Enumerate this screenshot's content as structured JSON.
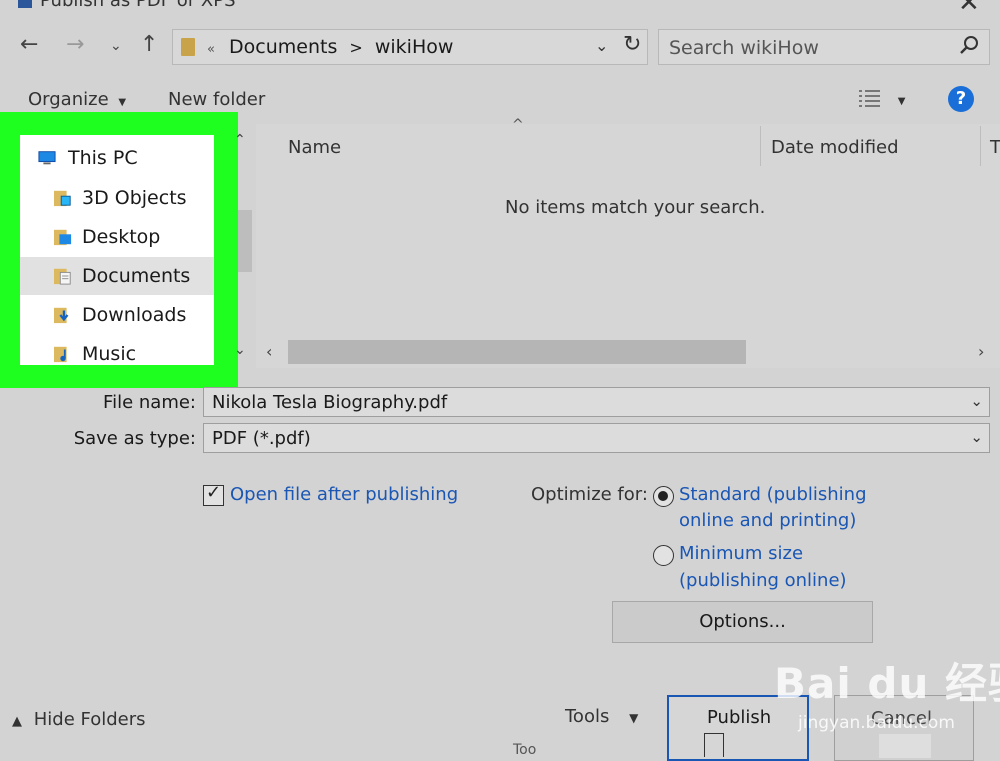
{
  "window": {
    "title": "Publish as PDF or XPS",
    "close_icon": "close-icon"
  },
  "nav": {
    "back_icon": "arrow-left-icon",
    "forward_icon": "arrow-right-icon",
    "recent_icon": "chevron-down-icon",
    "up_icon": "arrow-up-icon",
    "address": {
      "overflow": "«",
      "crumbs": [
        "Documents",
        "wikiHow"
      ],
      "separator": ">"
    },
    "refresh_icon": "refresh-icon",
    "search": {
      "placeholder": "Search wikiHow"
    }
  },
  "toolbar": {
    "organize": "Organize",
    "new_folder": "New folder",
    "view_icon": "view-options-icon",
    "help": "?"
  },
  "nav_pane": {
    "highlight_color": "#1fff1f",
    "items": [
      {
        "label": "This PC",
        "icon": "pc-icon",
        "selected": false
      },
      {
        "label": "3D Objects",
        "icon": "3d-objects-folder-icon",
        "selected": false
      },
      {
        "label": "Desktop",
        "icon": "desktop-folder-icon",
        "selected": false
      },
      {
        "label": "Documents",
        "icon": "documents-folder-icon",
        "selected": true
      },
      {
        "label": "Downloads",
        "icon": "downloads-folder-icon",
        "selected": false
      },
      {
        "label": "Music",
        "icon": "music-folder-icon",
        "selected": false
      }
    ]
  },
  "file_list": {
    "columns": [
      "Name",
      "Date modified",
      "T"
    ],
    "empty_message": "No items match your search."
  },
  "form": {
    "file_name_label": "File name:",
    "file_name_value": "Nikola Tesla Biography.pdf",
    "save_type_label": "Save as type:",
    "save_type_value": "PDF (*.pdf)",
    "open_after_label": "Open file after publishing",
    "open_after_checked": true,
    "optimize_label": "Optimize for:",
    "radio_standard": [
      "Standard (publishing",
      "online and printing)"
    ],
    "radio_standard_selected": true,
    "radio_minimum": [
      "Minimum size",
      "(publishing online)"
    ],
    "radio_minimum_selected": false,
    "options_button": "Options..."
  },
  "footer": {
    "hide_folders": "Hide Folders",
    "tools": "Tools",
    "publish": "Publish",
    "cancel": "Cancel",
    "stray_text": "Too",
    "watermark": "Bai du 经验",
    "watermark_url": "jingyan.baidu.com",
    "accent_color": "#1a56b4"
  }
}
